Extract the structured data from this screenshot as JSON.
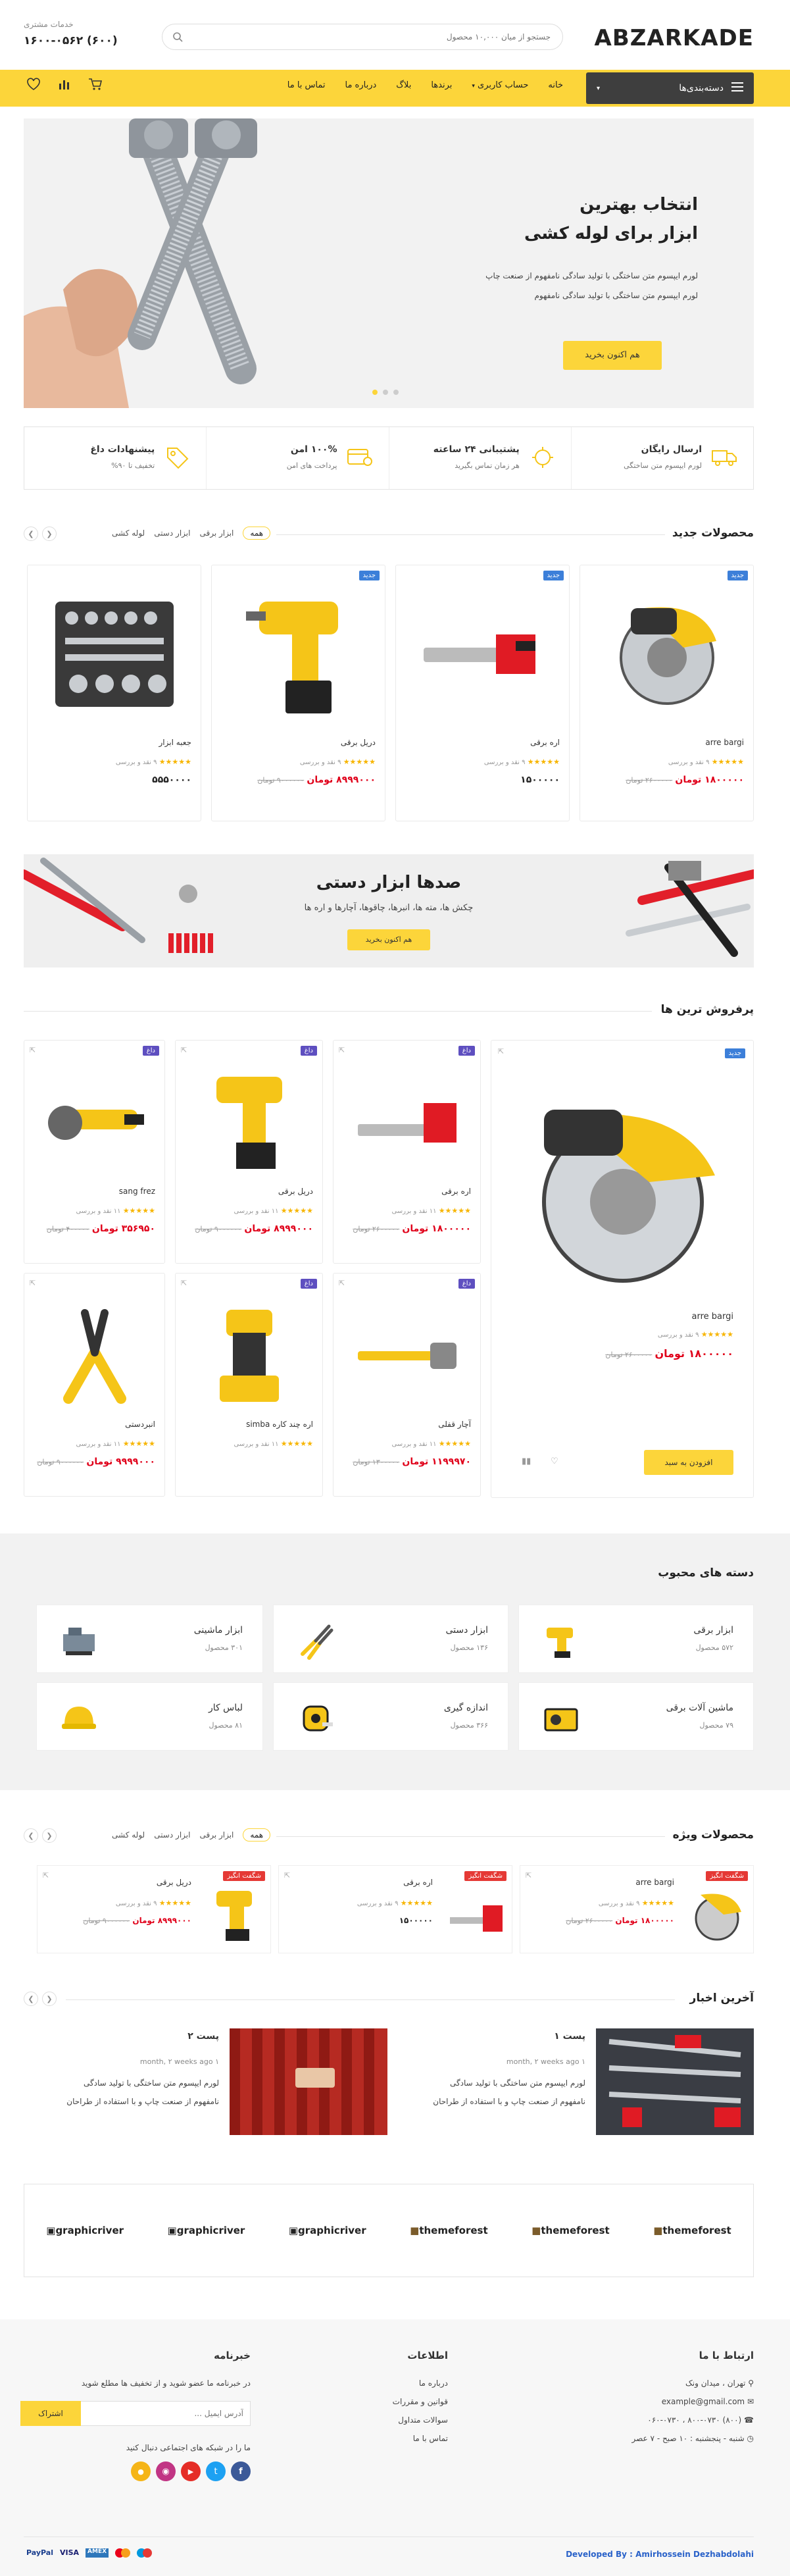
{
  "header": {
    "logo": "ABZARKADE",
    "search_placeholder": "جستجو از میان ۱۰,۰۰۰ محصول",
    "support_label": "خدمات مشتری",
    "support_phone": "(۶۰۰) ۱۶۰۰-۰۵۶۲"
  },
  "nav": {
    "categories_button": "دسته‌بندی‌ها",
    "items": [
      "خانه",
      "حساب کاربری",
      "برندها",
      "بلاگ",
      "درباره ما",
      "تماس با ما"
    ]
  },
  "hero": {
    "title_line1": "انتخاب بهترین",
    "title_line2": "ابزار برای لوله کشی",
    "desc_line1": "لورم ایپسوم متن ساختگی با تولید سادگی نامفهوم از صنعت چاپ",
    "desc_line2": "لورم ایپسوم متن ساختگی با تولید سادگی نامفهوم",
    "cta": "هم اکنون بخرید"
  },
  "features": [
    {
      "title": "ارسال رایگان",
      "sub": "لورم ایپسوم متن ساختگی"
    },
    {
      "title": "پشتیبانی ۲۴ ساعته",
      "sub": "هر زمان تماس بگیرید"
    },
    {
      "title": "۱۰۰% امن",
      "sub": "پرداخت های امن"
    },
    {
      "title": "پیشنهادات داغ",
      "sub": "تخفیف تا ۹۰%"
    }
  ],
  "new_products": {
    "title": "محصولات جدید",
    "tabs": [
      "همه",
      "ابزار برقی",
      "ابزار دستی",
      "لوله کشی"
    ],
    "items": [
      {
        "badge": "جدید",
        "name": "arre bargi",
        "reviews": "۹ نقد و بررسی",
        "price": "۱۸۰۰۰۰۰ تومان",
        "old": "۲۶۰۰۰۰۰ تومان"
      },
      {
        "badge": "جدید",
        "name": "اره برقی",
        "reviews": "۹ نقد و بررسی",
        "price": "۱۵۰۰۰۰۰",
        "old": ""
      },
      {
        "badge": "جدید",
        "name": "دریل برقی",
        "reviews": "۹ نقد و بررسی",
        "price": "۸۹۹۹۰۰۰ تومان",
        "old": "۹۰۰۰۰۰۰ تومان"
      },
      {
        "badge": "",
        "name": "جعبه ابزار",
        "reviews": "۹ نقد و بررسی",
        "price": "۵۵۵۰۰۰۰",
        "old": ""
      }
    ]
  },
  "banner": {
    "title": "صدها ابزار دستی",
    "desc": "چکش ها، مته ها، انبرها، چاقوها، آچارها و اره ها",
    "cta": "هم اکنون بخرید"
  },
  "best": {
    "title": "پرفروش ترین ها",
    "big": {
      "badge": "جدید",
      "name": "arre bargi",
      "reviews": "۹ نقد و بررسی",
      "price": "۱۸۰۰۰۰۰ تومان",
      "old": "۲۶۰۰۰۰۰ تومان",
      "cta": "افزودن به سبد"
    },
    "items": [
      {
        "badge": "داغ",
        "name": "اره برقی",
        "reviews": "۱۱ نقد و بررسی",
        "price": "۱۸۰۰۰۰۰ تومان",
        "old": "۲۶۰۰۰۰۰ تومان"
      },
      {
        "badge": "داغ",
        "name": "دریل برقی",
        "reviews": "۱۱ نقد و بررسی",
        "price": "۸۹۹۹۰۰۰ تومان",
        "old": "۹۰۰۰۰۰۰ تومان"
      },
      {
        "badge": "داغ",
        "name": "sang frez",
        "reviews": "۱۱ نقد و بررسی",
        "price": "۳۵۶۹۵۰ تومان",
        "old": "۴۰۰۰۰۰ تومان"
      },
      {
        "badge": "داغ",
        "name": "آچار قفلی",
        "reviews": "۱۱ نقد و بررسی",
        "price": "۱۱۹۹۹۷۰ تومان",
        "old": "۱۳۰۰۰۰۰ تومان"
      },
      {
        "badge": "داغ",
        "name": "اره چند کاره simba",
        "reviews": "۱۱ نقد و بررسی",
        "price": "",
        "old": ""
      },
      {
        "badge": "",
        "name": "انبردستی",
        "reviews": "۱۱ نقد و بررسی",
        "price": "۹۹۹۹۰۰۰ تومان",
        "old": "۹۰۰۰۰۰۰ تومان"
      }
    ]
  },
  "categories": {
    "title": "دسته های محبوب",
    "items": [
      {
        "name": "ابزار برقی",
        "count": "۵۷۲ محصول"
      },
      {
        "name": "ابزار دستی",
        "count": "۱۳۶ محصول"
      },
      {
        "name": "ابزار ماشینی",
        "count": "۳۰۱ محصول"
      },
      {
        "name": "ماشین آلات برقی",
        "count": "۷۹ محصول"
      },
      {
        "name": "اندازه گیری",
        "count": "۳۶۶ محصول"
      },
      {
        "name": "لباس کار",
        "count": "۸۱ محصول"
      }
    ]
  },
  "special": {
    "title": "محصولات ویژه",
    "tabs": [
      "همه",
      "ابزار برقی",
      "ابزار دستی",
      "لوله کشی"
    ],
    "items": [
      {
        "badge": "شگفت انگیز",
        "name": "arre bargi",
        "reviews": "۹ نقد و بررسی",
        "price": "۱۸۰۰۰۰۰ تومان",
        "old": "۲۶۰۰۰۰۰ تومان"
      },
      {
        "badge": "شگفت انگیز",
        "name": "اره برقی",
        "reviews": "۹ نقد و بررسی",
        "price": "۱۵۰۰۰۰۰",
        "old": ""
      },
      {
        "badge": "شگفت انگیز",
        "name": "دریل برقی",
        "reviews": "۹ نقد و بررسی",
        "price": "۸۹۹۹۰۰۰ تومان",
        "old": "۹۰۰۰۰۰۰ تومان"
      }
    ]
  },
  "news": {
    "title": "آخرین اخبار",
    "posts": [
      {
        "title": "پست ۱",
        "meta": "month, ۲ weeks ago ۱",
        "body1": "لورم ایپسوم متن ساختگی با تولید سادگی",
        "body2": "نامفهوم از صنعت چاپ و با استفاده از طراحان"
      },
      {
        "title": "پست ۲",
        "meta": "month, ۲ weeks ago ۱",
        "body1": "لورم ایپسوم متن ساختگی با تولید سادگی",
        "body2": "نامفهوم از صنعت چاپ و با استفاده از طراحان"
      }
    ]
  },
  "brands": [
    "graphicriver",
    "graphicriver",
    "graphicriver",
    "themeforest",
    "themeforest",
    "themeforest"
  ],
  "footer": {
    "contact_title": "ارتباط با ما",
    "address": "تهران ، میدان ونک",
    "email": "example@gmail.com",
    "phone": "(۸۰۰) ۸۰۰-۰۷۳۰ ، ۰۶۰-۰۷۳۰",
    "hours": "شنبه - پنجشنبه : ۱۰ صبح - ۷ عصر",
    "info_title": "اطلاعات",
    "info_links": [
      "درباره ما",
      "قوانین و مقررات",
      "سوالات متداول",
      "تماس با ما"
    ],
    "news_title": "خبرنامه",
    "news_text": "در خبرنامه ما عضو شوید و از تخفیف ها مطلع شوید",
    "email_placeholder": "آدرس ایمیل ...",
    "subscribe": "اشتراک",
    "social_text": "ما را در شبکه های اجتماعی دنبال کنید",
    "credit": "Developed By : Amirhossein Dezhabdolahi",
    "payments": [
      "PayPal",
      "VISA",
      "AMEX",
      "MC",
      "MAESTRO"
    ]
  },
  "colors": {
    "accent": "#fcd53a",
    "dark": "#3e3e3e",
    "price": "#e0001a"
  }
}
